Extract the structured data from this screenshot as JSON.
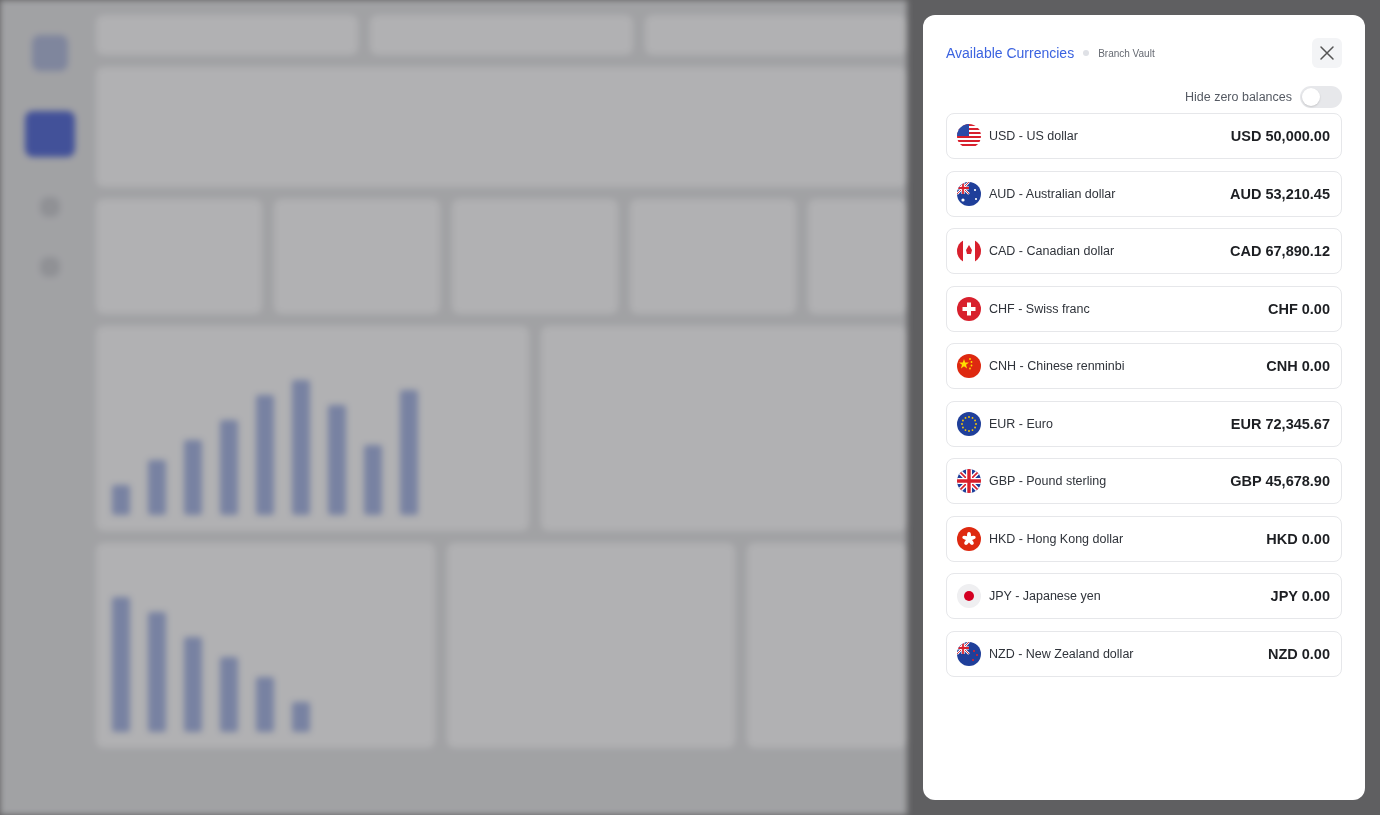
{
  "panel": {
    "title": "Available Currencies",
    "subtitle": "Branch Vault"
  },
  "hide_zero_balances": {
    "label": "Hide zero balances",
    "on": false
  },
  "currencies": [
    {
      "name": "USD - US dollar",
      "balance": "USD 50,000.00"
    },
    {
      "name": "AUD - Australian dollar",
      "balance": "AUD 53,210.45"
    },
    {
      "name": "CAD - Canadian dollar",
      "balance": "CAD 67,890.12"
    },
    {
      "name": "CHF - Swiss franc",
      "balance": "CHF 0.00"
    },
    {
      "name": "CNH - Chinese renminbi",
      "balance": "CNH 0.00"
    },
    {
      "name": "EUR - Euro",
      "balance": "EUR 72,345.67"
    },
    {
      "name": "GBP - Pound sterling",
      "balance": "GBP 45,678.90"
    },
    {
      "name": "HKD - Hong Kong dollar",
      "balance": "HKD 0.00"
    },
    {
      "name": "JPY - Japanese yen",
      "balance": "JPY 0.00"
    },
    {
      "name": "NZD - New Zealand dollar",
      "balance": "NZD 0.00"
    }
  ]
}
